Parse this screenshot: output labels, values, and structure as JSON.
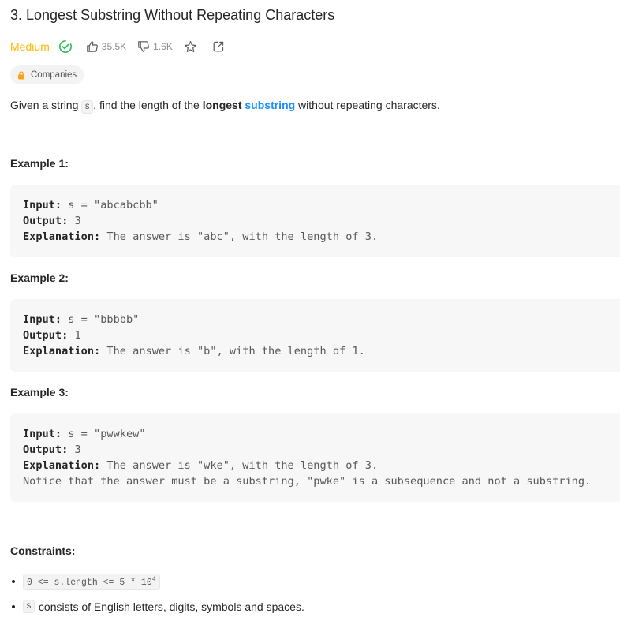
{
  "problem": {
    "title": "3. Longest Substring Without Repeating Characters",
    "difficulty": "Medium",
    "likes": "35.5K",
    "dislikes": "1.6K",
    "companies_label": "Companies"
  },
  "description": {
    "part1": "Given a string ",
    "var_s": "s",
    "part2": ", find the length of the ",
    "bold": "longest",
    "space": " ",
    "link": "substring",
    "part3": " without repeating characters."
  },
  "examples": [
    {
      "title": "Example 1:",
      "input_label": "Input:",
      "input": " s = \"abcabcbb\"",
      "output_label": "Output:",
      "output": " 3",
      "explanation_label": "Explanation:",
      "explanation": " The answer is \"abc\", with the length of 3."
    },
    {
      "title": "Example 2:",
      "input_label": "Input:",
      "input": " s = \"bbbbb\"",
      "output_label": "Output:",
      "output": " 1",
      "explanation_label": "Explanation:",
      "explanation": " The answer is \"b\", with the length of 1."
    },
    {
      "title": "Example 3:",
      "input_label": "Input:",
      "input": " s = \"pwwkew\"",
      "output_label": "Output:",
      "output": " 3",
      "explanation_label": "Explanation:",
      "explanation": " The answer is \"wke\", with the length of 3.",
      "note": "Notice that the answer must be a substring, \"pwke\" is a subsequence and not a substring."
    }
  ],
  "constraints": {
    "title": "Constraints:",
    "c1_code": "0 <= s.length <= 5 * 10",
    "c1_sup": "4",
    "c2_code": "s",
    "c2_text": "consists of English letters, digits, symbols and spaces."
  },
  "colors": {
    "difficulty": "#ffb800",
    "solved": "#2cbb5d",
    "link": "#1a90ff",
    "lock": "#ffa116"
  }
}
